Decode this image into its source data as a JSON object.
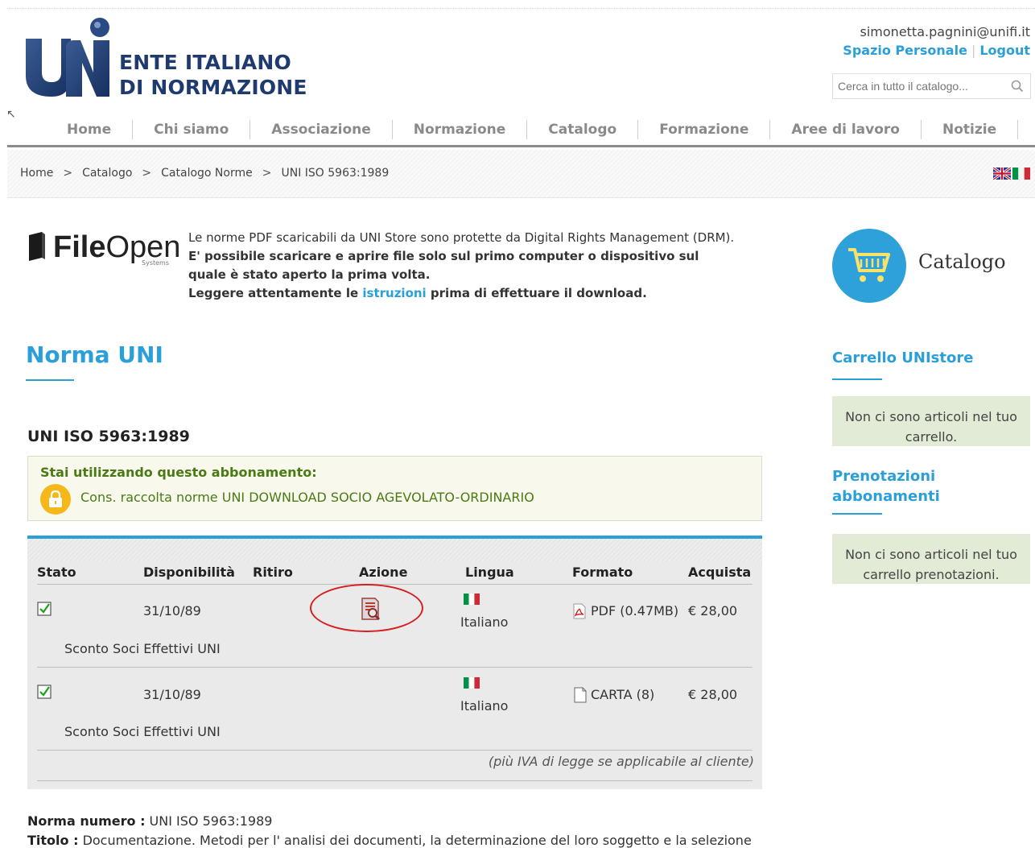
{
  "header": {
    "logo_line1": "ENTE ITALIANO",
    "logo_line2": "DI NORMAZIONE",
    "user_email": "simonetta.pagnini@unifi.it",
    "personal_space": "Spazio Personale",
    "logout": "Logout",
    "search_placeholder": "Cerca in tutto il catalogo..."
  },
  "nav": {
    "items": [
      "Home",
      "Chi siamo",
      "Associazione",
      "Normazione",
      "Catalogo",
      "Formazione",
      "Aree di lavoro",
      "Notizie"
    ]
  },
  "breadcrumb": {
    "items": [
      "Home",
      "Catalogo",
      "Catalogo Norme",
      "UNI ISO 5963:1989"
    ],
    "separator": ">"
  },
  "fileopen": {
    "brand_bold": "File",
    "brand_light": "Open",
    "brand_sub": "Systems",
    "line1": "Le norme PDF scaricabili da UNI Store sono protette da Digital Rights Management (DRM).",
    "line2": "E' possibile scaricare e aprire file solo sul primo computer o dispositivo sul quale è stato aperto la prima volta.",
    "line3_before": "Leggere attentamente le ",
    "line3_link": "istruzioni",
    "line3_after": " prima di effettuare il download."
  },
  "norma": {
    "title": "Norma UNI",
    "code": "UNI ISO 5963:1989",
    "subscription_heading": "Stai utilizzando questo abbonamento:",
    "subscription_name": "Cons. raccolta norme UNI DOWNLOAD SOCIO AGEVOLATO-ORDINARIO"
  },
  "table": {
    "headers": [
      "Stato",
      "Disponibilità",
      "Ritiro",
      "Azione",
      "Lingua",
      "Formato",
      "Acquista"
    ],
    "rows": [
      {
        "date": "31/10/89",
        "language": "Italiano",
        "format": "PDF (0.47MB)",
        "price": "€ 28,00",
        "discount": "Sconto Soci Effettivi UNI"
      },
      {
        "date": "31/10/89",
        "language": "Italiano",
        "format": "CARTA (8)",
        "price": "€ 28,00",
        "discount": "Sconto Soci Effettivi UNI"
      }
    ],
    "note": "(più IVA di legge se applicabile al cliente)"
  },
  "details": {
    "number_label": "Norma numero :",
    "number_value": " UNI ISO 5963:1989",
    "title_label": "Titolo :",
    "title_value": " Documentazione. Metodi per l' analisi dei documenti, la determinazione del loro soggetto e la selezione"
  },
  "sidebar": {
    "catalogo": "Catalogo",
    "cart_title": "Carrello UNIstore",
    "cart_empty": "Non ci sono articoli nel tuo carrello.",
    "prenot_title": "Prenotazioni abbonamenti",
    "prenot_empty": "Non ci sono articoli nel tuo carrello prenotazioni."
  },
  "colors": {
    "accent": "#2a9fd8",
    "logo_blue": "#1f3a6e",
    "subscription_green": "#4a7a15",
    "highlight_red": "#d61f1f"
  }
}
